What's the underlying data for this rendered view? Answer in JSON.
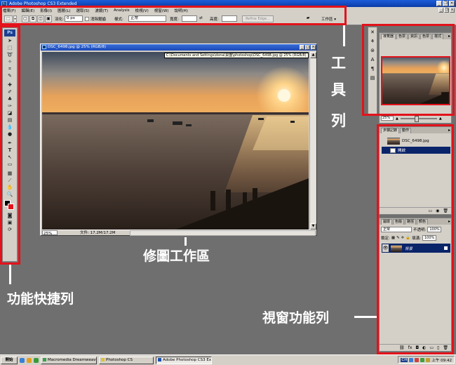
{
  "window": {
    "title": "Adobe Photoshop CS3 Extended",
    "app_icon": "Ps"
  },
  "menu": [
    "檔案(F)",
    "編輯(E)",
    "影像(I)",
    "圖層(L)",
    "選取(S)",
    "濾鏡(T)",
    "Analysis",
    "檢視(V)",
    "視窗(W)",
    "說明(H)"
  ],
  "options_bar": {
    "feather_label": "羽化:",
    "feather_value": "0 px",
    "antialias_label": "消除鋸齒",
    "style_label": "樣式:",
    "style_value": "正常",
    "width_label": "寬度:",
    "height_label": "高度:",
    "refine_edge": "Refine Edge...",
    "workspace": "工作區 ▾"
  },
  "toolbox": {
    "logo": "Ps"
  },
  "document": {
    "title": "DSC_6498.jpg @ 25% (RGB/8)",
    "path_tip": "C:\\Documents and Settings\\dona\\桌面\\photoshop\\DSC_6498.jpg @ 25% (RGB/8)",
    "zoom": "25%",
    "doc_info": "文件: 17.2M/17.2M"
  },
  "navigator": {
    "tabs": [
      "導覽器",
      "色票",
      "資訊",
      "色票",
      "樣式"
    ],
    "zoom": "25%"
  },
  "history": {
    "tabs": [
      "步驟記錄",
      "動作"
    ],
    "snapshot": "DSC_6498.jpg",
    "step": "開啟"
  },
  "layers": {
    "tabs": [
      "圖層",
      "色版",
      "路徑",
      "顏色"
    ],
    "blend_mode": "正常",
    "opacity_label": "不透明:",
    "opacity": "100%",
    "lock_label": "鎖定:",
    "fill_label": "填滿:",
    "fill": "100%",
    "layer_name": "背景"
  },
  "taskbar": {
    "start": "開始",
    "tasks": [
      "Macromedia Dreamweave...",
      "Photoshop CS",
      "Adobe Photoshop CS3 Ex..."
    ],
    "tray_input": "CH",
    "clock": "上午 09:42"
  },
  "annotations": {
    "toolbar_chars": [
      "工",
      "具",
      "列"
    ],
    "work_area": "修圖工作區",
    "shortcut_bar": "功能快捷列",
    "panel_bar": "視窗功能列"
  },
  "colors": {
    "highlight": "#e3121b",
    "workspace": "#6f6f6f",
    "title_blue": "#0a3ca8",
    "selection": "#0a246a"
  }
}
